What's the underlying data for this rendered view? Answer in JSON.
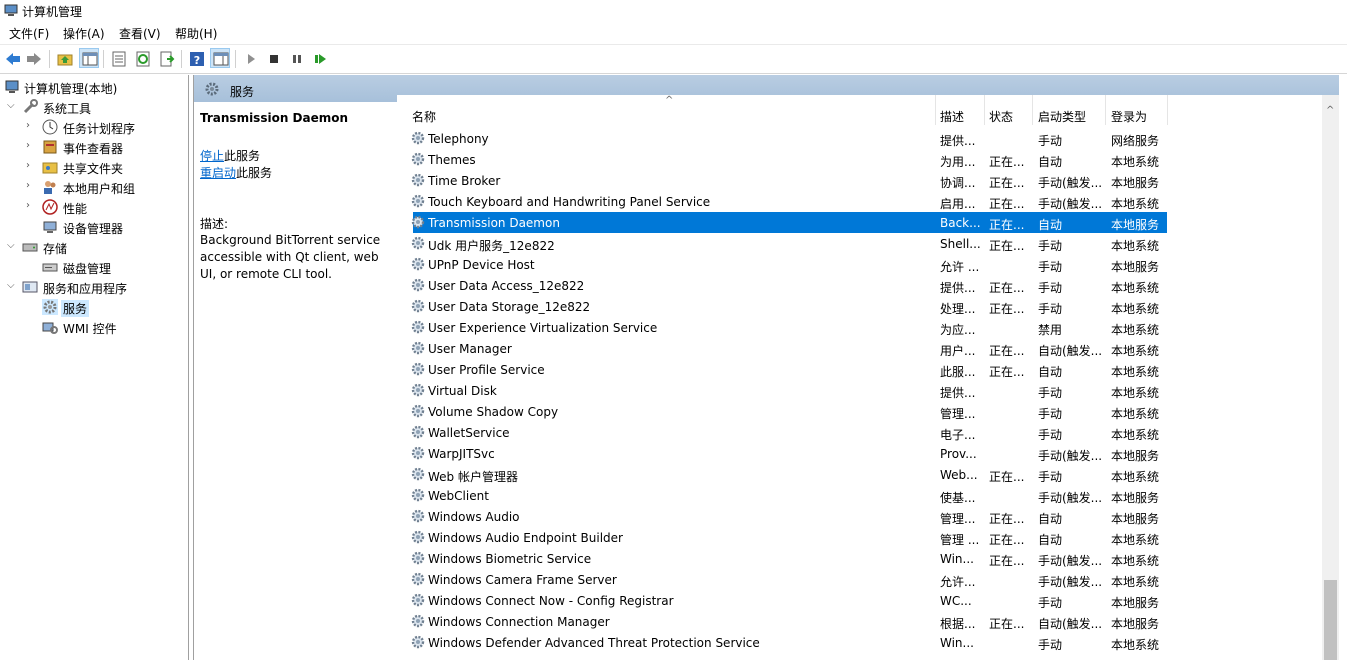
{
  "window": {
    "title": "计算机管理"
  },
  "menu": [
    "文件(F)",
    "操作(A)",
    "查看(V)",
    "帮助(H)"
  ],
  "tree": [
    {
      "label": "计算机管理(本地)",
      "icon": "computer-management-icon"
    },
    {
      "label": "系统工具",
      "icon": "system-tools-icon"
    },
    {
      "label": "任务计划程序",
      "icon": "task-scheduler-icon"
    },
    {
      "label": "事件查看器",
      "icon": "event-viewer-icon"
    },
    {
      "label": "共享文件夹",
      "icon": "shared-folders-icon"
    },
    {
      "label": "本地用户和组",
      "icon": "local-users-icon"
    },
    {
      "label": "性能",
      "icon": "performance-icon"
    },
    {
      "label": "设备管理器",
      "icon": "device-manager-icon"
    },
    {
      "label": "存储",
      "icon": "storage-icon"
    },
    {
      "label": "磁盘管理",
      "icon": "disk-management-icon"
    },
    {
      "label": "服务和应用程序",
      "icon": "services-apps-icon"
    },
    {
      "label": "服务",
      "icon": "services-icon"
    },
    {
      "label": "WMI 控件",
      "icon": "wmi-control-icon"
    }
  ],
  "main": {
    "header_title": "服务",
    "selected_service": "Transmission Daemon",
    "stop_link": "停止",
    "stop_suffix": "此服务",
    "restart_link": "重启动",
    "restart_suffix": "此服务",
    "desc_label": "描述:",
    "desc_text": "Background BitTorrent service accessible with Qt client, web UI, or remote CLI tool."
  },
  "columns": {
    "name": "名称",
    "desc": "描述",
    "state": "状态",
    "start": "启动类型",
    "logon": "登录为"
  },
  "services": [
    {
      "name": "Telephony",
      "desc": "提供...",
      "state": "",
      "start": "手动",
      "logon": "网络服务"
    },
    {
      "name": "Themes",
      "desc": "为用...",
      "state": "正在...",
      "start": "自动",
      "logon": "本地系统"
    },
    {
      "name": "Time Broker",
      "desc": "协调...",
      "state": "正在...",
      "start": "手动(触发...",
      "logon": "本地服务"
    },
    {
      "name": "Touch Keyboard and Handwriting Panel Service",
      "desc": "启用...",
      "state": "正在...",
      "start": "手动(触发...",
      "logon": "本地系统"
    },
    {
      "name": "Transmission Daemon",
      "desc": "Back...",
      "state": "正在...",
      "start": "自动",
      "logon": "本地服务",
      "selected": true
    },
    {
      "name": "Udk 用户服务_12e822",
      "desc": "Shell...",
      "state": "正在...",
      "start": "手动",
      "logon": "本地系统"
    },
    {
      "name": "UPnP Device Host",
      "desc": "允许 ...",
      "state": "",
      "start": "手动",
      "logon": "本地服务"
    },
    {
      "name": "User Data Access_12e822",
      "desc": "提供...",
      "state": "正在...",
      "start": "手动",
      "logon": "本地系统"
    },
    {
      "name": "User Data Storage_12e822",
      "desc": "处理...",
      "state": "正在...",
      "start": "手动",
      "logon": "本地系统"
    },
    {
      "name": "User Experience Virtualization Service",
      "desc": "为应...",
      "state": "",
      "start": "禁用",
      "logon": "本地系统"
    },
    {
      "name": "User Manager",
      "desc": "用户...",
      "state": "正在...",
      "start": "自动(触发...",
      "logon": "本地系统"
    },
    {
      "name": "User Profile Service",
      "desc": "此服...",
      "state": "正在...",
      "start": "自动",
      "logon": "本地系统"
    },
    {
      "name": "Virtual Disk",
      "desc": "提供...",
      "state": "",
      "start": "手动",
      "logon": "本地系统"
    },
    {
      "name": "Volume Shadow Copy",
      "desc": "管理...",
      "state": "",
      "start": "手动",
      "logon": "本地系统"
    },
    {
      "name": "WalletService",
      "desc": "电子...",
      "state": "",
      "start": "手动",
      "logon": "本地系统"
    },
    {
      "name": "WarpJITSvc",
      "desc": "Prov...",
      "state": "",
      "start": "手动(触发...",
      "logon": "本地服务"
    },
    {
      "name": "Web 帐户管理器",
      "desc": "Web...",
      "state": "正在...",
      "start": "手动",
      "logon": "本地系统"
    },
    {
      "name": "WebClient",
      "desc": "使基...",
      "state": "",
      "start": "手动(触发...",
      "logon": "本地服务"
    },
    {
      "name": "Windows Audio",
      "desc": "管理...",
      "state": "正在...",
      "start": "自动",
      "logon": "本地服务"
    },
    {
      "name": "Windows Audio Endpoint Builder",
      "desc": "管理 ...",
      "state": "正在...",
      "start": "自动",
      "logon": "本地系统"
    },
    {
      "name": "Windows Biometric Service",
      "desc": "Win...",
      "state": "正在...",
      "start": "手动(触发...",
      "logon": "本地系统"
    },
    {
      "name": "Windows Camera Frame Server",
      "desc": "允许...",
      "state": "",
      "start": "手动(触发...",
      "logon": "本地系统"
    },
    {
      "name": "Windows Connect Now - Config Registrar",
      "desc": "WC...",
      "state": "",
      "start": "手动",
      "logon": "本地服务"
    },
    {
      "name": "Windows Connection Manager",
      "desc": "根据...",
      "state": "正在...",
      "start": "自动(触发...",
      "logon": "本地服务"
    },
    {
      "name": "Windows Defender Advanced Threat Protection Service",
      "desc": "Win...",
      "state": "",
      "start": "手动",
      "logon": "本地系统"
    }
  ],
  "colors": {
    "selection": "#0078d7",
    "header": "#a7c0da",
    "link": "#0066cc"
  }
}
